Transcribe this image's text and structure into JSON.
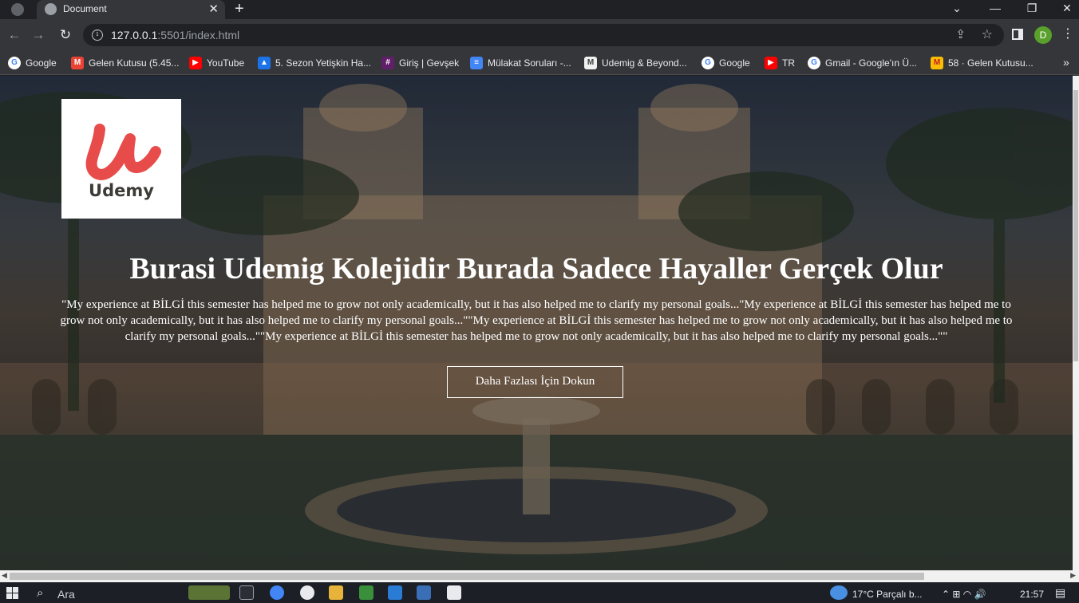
{
  "browser": {
    "tab": {
      "title": "Document",
      "close_glyph": "✕"
    },
    "new_tab_glyph": "+",
    "window_controls": {
      "dropdown": "⌄",
      "minimize": "—",
      "restore": "❐",
      "close": "✕"
    },
    "nav": {
      "back": "←",
      "forward": "→",
      "reload": "↻"
    },
    "address": {
      "host": "127.0.0.1",
      "rest": ":5501/index.html",
      "info_glyph": "i"
    },
    "actions": {
      "share": "⇪",
      "star": "☆",
      "avatar_letter": "D",
      "menu": "⋮"
    },
    "bookmarks": [
      {
        "label": "Google",
        "icon": "google-icon",
        "glyph": "G"
      },
      {
        "label": "Gelen Kutusu (5.45...",
        "icon": "gmail-icon",
        "glyph": "M"
      },
      {
        "label": "YouTube",
        "icon": "youtube-icon",
        "glyph": "▶"
      },
      {
        "label": "5. Sezon Yetişkin Ha...",
        "icon": "person-icon",
        "glyph": "▲"
      },
      {
        "label": "Giriş | Gevşek",
        "icon": "slack-icon",
        "glyph": "#"
      },
      {
        "label": "Mülakat Soruları -...",
        "icon": "document-icon",
        "glyph": "≡"
      },
      {
        "label": "Udemig & Beyond...",
        "icon": "udemy-icon",
        "glyph": "M"
      },
      {
        "label": "Google",
        "icon": "google-icon",
        "glyph": "G"
      },
      {
        "label": "TR",
        "icon": "youtube-icon",
        "glyph": "▶"
      },
      {
        "label": "Gmail - Google'ın Ü...",
        "icon": "google-icon",
        "glyph": "G"
      },
      {
        "label": "58 · Gelen Kutusu...",
        "icon": "gmail-icon",
        "glyph": "M"
      }
    ],
    "bookmarks_more": "»"
  },
  "page": {
    "logo_text": "Udemy",
    "title": "Burasi Udemig Kolejidir Burada Sadece Hayaller Gerçek Olur",
    "paragraph": "\"My experience at BİLGİ this semester has helped me to grow not only academically, but it has also helped me to clarify my personal goals...\"My experience at BİLGİ this semester has helped me to grow not only academically, but it has also helped me to clarify my personal goals...\"\"My experience at BİLGİ this semester has helped me to grow not only academically, but it has also helped me to clarify my personal goals...\"\"My experience at BİLGİ this semester has helped me to grow not only academically, but it has also helped me to clarify my personal goals...\"\"",
    "cta_label": "Daha Fazlası İçin Dokun",
    "colors": {
      "logo_red": "#e84c4a",
      "overlay": "#0a0e18"
    }
  },
  "taskbar": {
    "search_glyph": "⌕",
    "search_label": "Ara",
    "weather": "17°C  Parçalı b...",
    "tray_icons": "⌃  ⊞  ◠  🔊",
    "clock": "21:57",
    "notify_glyph": "▤"
  }
}
